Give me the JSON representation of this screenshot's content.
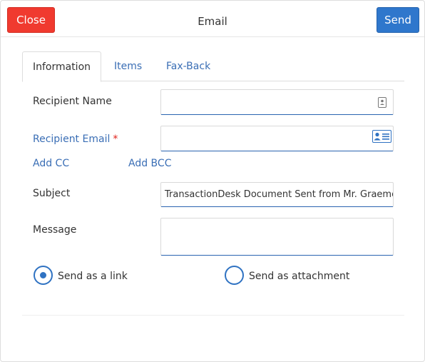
{
  "header": {
    "close_label": "Close",
    "title": "Email",
    "send_label": "Send"
  },
  "tabs": [
    {
      "label": "Information",
      "active": true
    },
    {
      "label": "Items",
      "active": false
    },
    {
      "label": "Fax-Back",
      "active": false
    }
  ],
  "form": {
    "recipient_name": {
      "label": "Recipient Name",
      "value": "",
      "icon": "contact-icon"
    },
    "recipient_email": {
      "label": "Recipient Email",
      "required_mark": "*",
      "value": "",
      "icon": "address-card-icon"
    },
    "add_cc": "Add CC",
    "add_bcc": "Add BCC",
    "subject": {
      "label": "Subject",
      "value": "TransactionDesk Document Sent from Mr. Graeme Car"
    },
    "message": {
      "label": "Message",
      "value": ""
    },
    "send_options": [
      {
        "label": "Send as a link",
        "selected": true
      },
      {
        "label": "Send as attachment",
        "selected": false
      }
    ]
  },
  "colors": {
    "close": "#f03a2f",
    "send": "#2f77cc",
    "link": "#3a6eb5",
    "required": "#e0211a"
  }
}
